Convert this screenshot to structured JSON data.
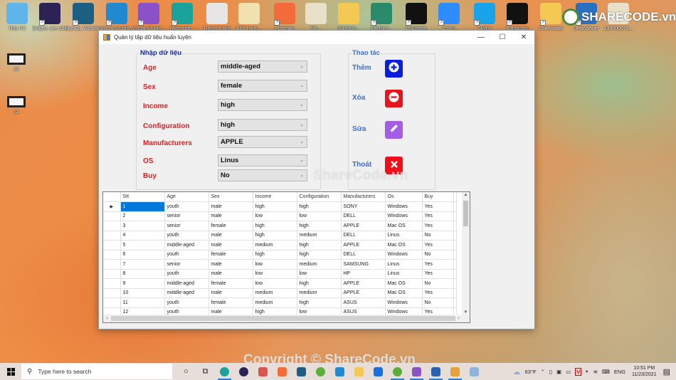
{
  "desktop": {
    "icons_top": [
      {
        "label": "This PC",
        "icon": "computer-icon",
        "color": "#5fb4ea"
      },
      {
        "label": "Eclipse Jee 2019-09",
        "icon": "eclipse-icon",
        "color": "#2c2255"
      },
      {
        "label": "MySQL Workben...",
        "icon": "mysql-icon",
        "color": "#1d5e85"
      },
      {
        "label": "Visual Studio...",
        "icon": "vscode-icon",
        "color": "#1f8ad2"
      },
      {
        "label": "Visual Studio...",
        "icon": "visual-studio-icon",
        "color": "#8b52c8"
      },
      {
        "label": "Microsoft...",
        "icon": "edge-icon",
        "color": "#1aa39a"
      },
      {
        "label": "Recycle Bin",
        "icon": "recycle-bin-icon",
        "color": "#e6e6e6"
      },
      {
        "label": "Bảng tính...",
        "icon": "file-icon",
        "color": "#f2e1b0"
      },
      {
        "label": "Postman",
        "icon": "postman-icon",
        "color": "#f26b3a"
      },
      {
        "label": "file...",
        "icon": "file-icon",
        "color": "#e8e0c8"
      },
      {
        "label": "Solution...",
        "icon": "folder-icon",
        "color": "#f3c853"
      },
      {
        "label": "Internet...",
        "icon": "app-icon",
        "color": "#2a8a6a"
      },
      {
        "label": "PyCharm",
        "icon": "pycharm-icon",
        "color": "#111111"
      },
      {
        "label": "Zoom",
        "icon": "zoom-icon",
        "color": "#2d8cff"
      },
      {
        "label": "Skype",
        "icon": "skype-icon",
        "color": "#1aa3e8"
      },
      {
        "label": "Bandicam",
        "icon": "bandicam-icon",
        "color": "#111111"
      },
      {
        "label": "Downloads",
        "icon": "downloads-folder-icon",
        "color": "#f3c853"
      },
      {
        "label": "UltraViewer",
        "icon": "ultraviewer-icon",
        "color": "#2a6fc0"
      },
      {
        "label": "139700578...",
        "icon": "file-icon",
        "color": "#e8e0c8"
      }
    ],
    "icons_left": [
      {
        "label": "s1",
        "icon": "screenshot-icon"
      },
      {
        "label": "s2",
        "icon": "screenshot-icon"
      }
    ]
  },
  "window": {
    "title": "Quản lý tập dữ liệu huấn luyện",
    "controls": {
      "minimize": "—",
      "maximize": "☐",
      "close": "✕"
    },
    "input_group": {
      "title": "Nhập dữ liệu",
      "fields": [
        {
          "label": "Age",
          "value": "middle-aged"
        },
        {
          "label": "Sex",
          "value": "female"
        },
        {
          "label": "Income",
          "value": "high"
        },
        {
          "label": "Configuration",
          "value": "high"
        },
        {
          "label": "Manufacturers",
          "value": "APPLE"
        },
        {
          "label": "OS",
          "value": "Linus"
        },
        {
          "label": "Buy",
          "value": "No"
        }
      ]
    },
    "action_group": {
      "title": "Thao tác",
      "actions": [
        {
          "label": "Thêm",
          "icon": "plus-icon",
          "color": "#0a1ee0"
        },
        {
          "label": "Xóa",
          "icon": "minus-icon",
          "color": "#e8141c"
        },
        {
          "label": "Sửa",
          "icon": "pencil-icon",
          "color": "#a45ee6"
        },
        {
          "label": "Thoát",
          "icon": "close-icon",
          "color": "#f0101a"
        }
      ]
    },
    "grid": {
      "columns": [
        "Stt",
        "Age",
        "Sex",
        "Income",
        "Configuration",
        "Manufacturers",
        "Os",
        "Buy"
      ],
      "selected_row": 0,
      "rows": [
        [
          "1",
          "youth",
          "male",
          "high",
          "high",
          "SONY",
          "Windows",
          "Yes"
        ],
        [
          "2",
          "senior",
          "male",
          "low",
          "low",
          "DELL",
          "Windows",
          "Yes"
        ],
        [
          "3",
          "senior",
          "female",
          "high",
          "high",
          "APPLE",
          "Mac OS",
          "Yes"
        ],
        [
          "4",
          "youth",
          "male",
          "high",
          "medium",
          "DELL",
          "Linus",
          "No"
        ],
        [
          "5",
          "middle-aged",
          "male",
          "medium",
          "high",
          "APPLE",
          "Mac OS",
          "Yes"
        ],
        [
          "6",
          "youth",
          "female",
          "high",
          "high",
          "DELL",
          "Windows",
          "No"
        ],
        [
          "7",
          "senior",
          "male",
          "low",
          "medium",
          "SAMSUNG",
          "Linus",
          "Yes"
        ],
        [
          "8",
          "youth",
          "male",
          "low",
          "low",
          "HP",
          "Linus",
          "Yes"
        ],
        [
          "9",
          "middle-aged",
          "female",
          "low",
          "high",
          "APPLE",
          "Mac OS",
          "No"
        ],
        [
          "10",
          "middle-aged",
          "male",
          "medium",
          "medium",
          "APPLE",
          "Mac OS",
          "Yes"
        ],
        [
          "11",
          "youth",
          "female",
          "medium",
          "high",
          "ASUS",
          "Windows",
          "No"
        ],
        [
          "12",
          "youth",
          "male",
          "high",
          "low",
          "ASUS",
          "Windows",
          "Yes"
        ]
      ]
    }
  },
  "watermarks": {
    "center": "ShareCode.vn",
    "bottom": "Copyright © ShareCode.vn",
    "logo": "SHARECODE.vn"
  },
  "taskbar": {
    "search_placeholder": "Type here to search",
    "pinned": [
      {
        "icon": "cortana-icon",
        "glyph": "○",
        "color": "#222"
      },
      {
        "icon": "task-view-icon",
        "glyph": "⧉",
        "color": "#222"
      },
      {
        "icon": "edge-icon",
        "glyph": "",
        "color": "#1aa39a",
        "active": true
      },
      {
        "icon": "eclipse-icon",
        "glyph": "",
        "color": "#2c2255"
      },
      {
        "icon": "network-app-icon",
        "glyph": "",
        "color": "#d9534f"
      },
      {
        "icon": "postman-icon",
        "glyph": "",
        "color": "#f26b3a"
      },
      {
        "icon": "mysql-icon",
        "glyph": "",
        "color": "#1d5e85"
      },
      {
        "icon": "spring-icon",
        "glyph": "",
        "color": "#5aae3a"
      },
      {
        "icon": "vscode-icon",
        "glyph": "",
        "color": "#1f8ad2"
      },
      {
        "icon": "file-explorer-icon",
        "glyph": "",
        "color": "#f3c853"
      },
      {
        "icon": "zalo-icon",
        "glyph": "",
        "color": "#1a6fe0"
      },
      {
        "icon": "spring-icon",
        "glyph": "",
        "color": "#5aae3a",
        "active": true
      },
      {
        "icon": "visual-studio-icon",
        "glyph": "",
        "color": "#8b52c8",
        "active": true
      },
      {
        "icon": "word-icon",
        "glyph": "",
        "color": "#2b5fb0",
        "active": true
      },
      {
        "icon": "winforms-app-icon",
        "glyph": "",
        "color": "#e4a23a",
        "active": true
      },
      {
        "icon": "paint-icon",
        "glyph": "",
        "color": "#8fb3d9"
      }
    ],
    "weather": "63°F",
    "language": "ENG",
    "time": "10:51 PM",
    "date": "11/23/2021"
  }
}
